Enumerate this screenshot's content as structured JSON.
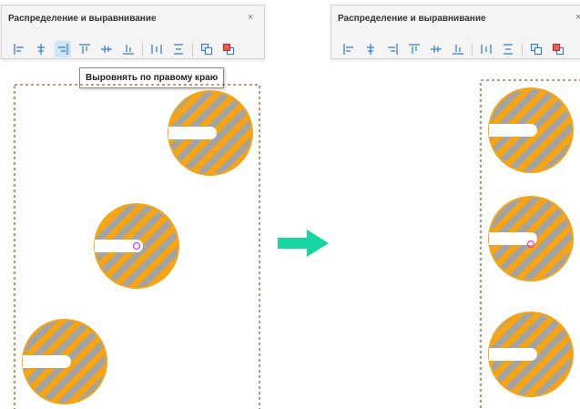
{
  "panel_left": {
    "title": "Распределение и выравнивание",
    "close": "×"
  },
  "panel_right": {
    "title": "Распределение и выравнивание",
    "close": "×"
  },
  "tooltip": {
    "text": "Выровнять по правому краю"
  },
  "toolbar": {
    "active_tool": "align-right",
    "tools": [
      "align-left",
      "align-horizontal-center",
      "align-right",
      "align-top",
      "align-vertical-center",
      "align-bottom",
      "distribute-horizontal",
      "distribute-vertical",
      "send-to-back",
      "bring-to-front"
    ]
  },
  "colors": {
    "shape_fill": "#a3a3a3",
    "shape_stripe": "#f5a416",
    "selection_border": "#9b5d2a",
    "arrow": "#17d6a1",
    "tool_icon": "#3b82c4",
    "tool_active_bg": "#cfe3f7",
    "pivot_marker": "#e040e0"
  }
}
